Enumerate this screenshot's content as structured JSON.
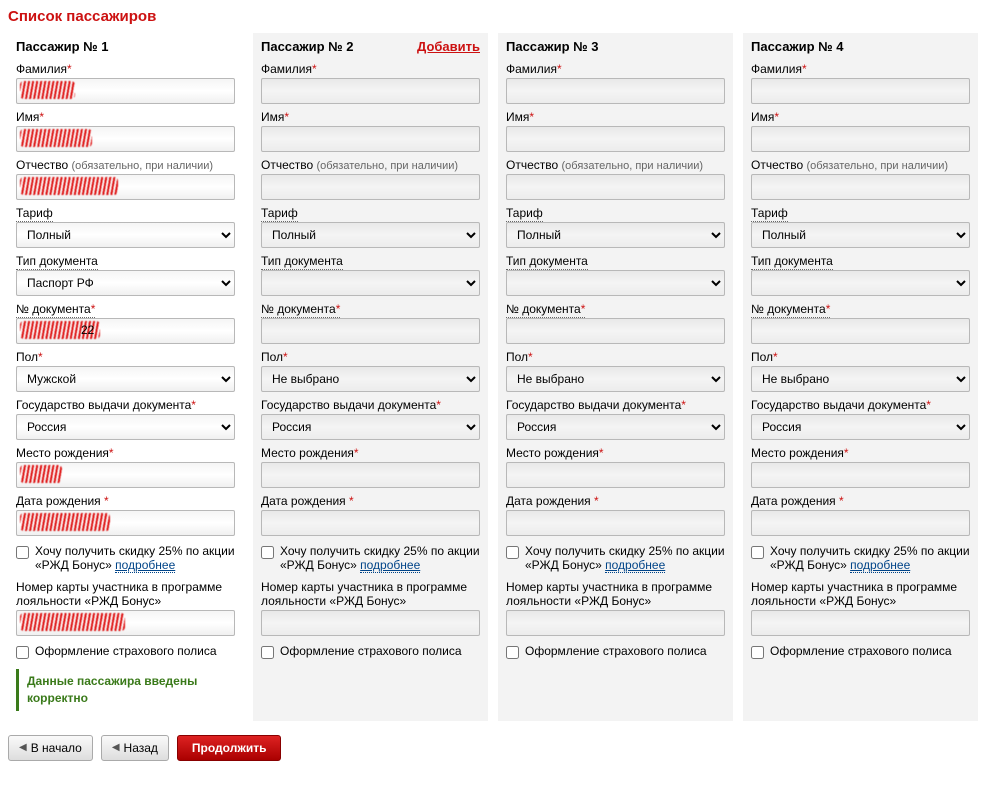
{
  "page": {
    "title": "Список пассажиров"
  },
  "labels": {
    "surname": "Фамилия",
    "name": "Имя",
    "patronymic": "Отчество",
    "patronymic_note": "(обязательно, при наличии)",
    "tariff": "Тариф",
    "doc_type": "Тип документа",
    "doc_no": "№ документа",
    "sex": "Пол",
    "issuing_country": "Государство выдачи документа",
    "birthplace": "Место рождения",
    "birthdate": "Дата рождения ",
    "discount_text_a": "Хочу получить скидку 25% по акции «РЖД Бонус» ",
    "discount_link": "подробнее",
    "bonus_card": "Номер карты участника в программе лояльности «РЖД Бонус»",
    "insurance": "Оформление страхового полиса",
    "status_ok": "Данные пассажира введены корректно",
    "add": "Добавить"
  },
  "options": {
    "tariff": [
      "Полный"
    ],
    "doc_type_p1": [
      "Паспорт РФ"
    ],
    "doc_type_blank": [
      ""
    ],
    "sex_p1": [
      "Мужской"
    ],
    "sex_blank": [
      "Не выбрано"
    ],
    "country": [
      "Россия"
    ]
  },
  "passengers": [
    {
      "title": "Пассажир № 1",
      "active": true,
      "add": false
    },
    {
      "title": "Пассажир № 2",
      "active": false,
      "add": true
    },
    {
      "title": "Пассажир № 3",
      "active": false,
      "add": false
    },
    {
      "title": "Пассажир № 4",
      "active": false,
      "add": false
    }
  ],
  "nav": {
    "start": "В начало",
    "back": "Назад",
    "continue": "Продолжить"
  }
}
